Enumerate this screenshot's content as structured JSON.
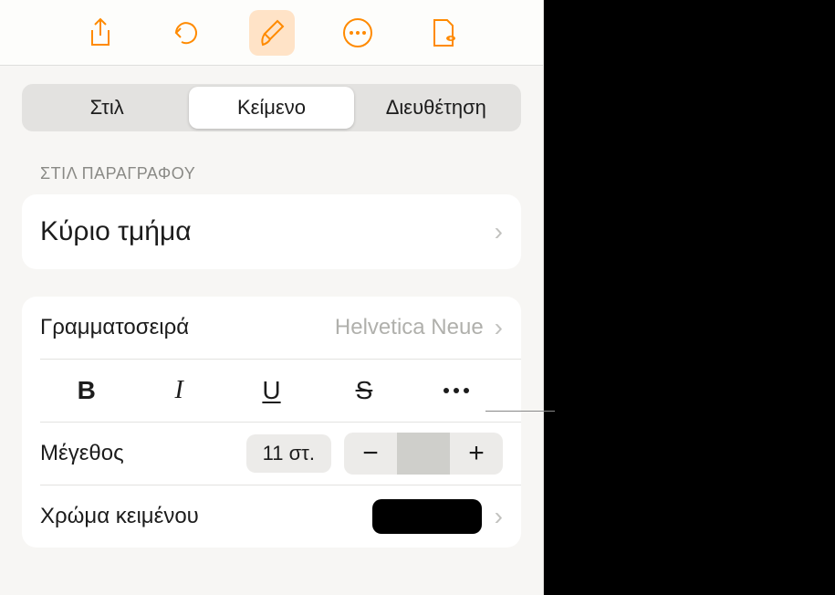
{
  "toolbar": {
    "share": "share-icon",
    "undo": "undo-icon",
    "format": "format-brush-icon",
    "more": "more-icon",
    "collab": "collab-icon"
  },
  "tabs": {
    "style": "Στιλ",
    "text": "Κείμενο",
    "arrange": "Διευθέτηση"
  },
  "paragraph": {
    "section_label": "ΣΤΙΛ ΠΑΡΑΓΡΑΦΟΥ",
    "style_name": "Κύριο τμήμα"
  },
  "font": {
    "label": "Γραμματοσειρά",
    "value": "Helvetica Neue"
  },
  "text_styles": {
    "bold": "B",
    "italic": "I",
    "underline": "U",
    "strike": "S"
  },
  "size": {
    "label": "Μέγεθος",
    "value": "11 στ.",
    "minus": "−",
    "plus": "+"
  },
  "color": {
    "label": "Χρώμα κειμένου",
    "value": "#000000"
  }
}
